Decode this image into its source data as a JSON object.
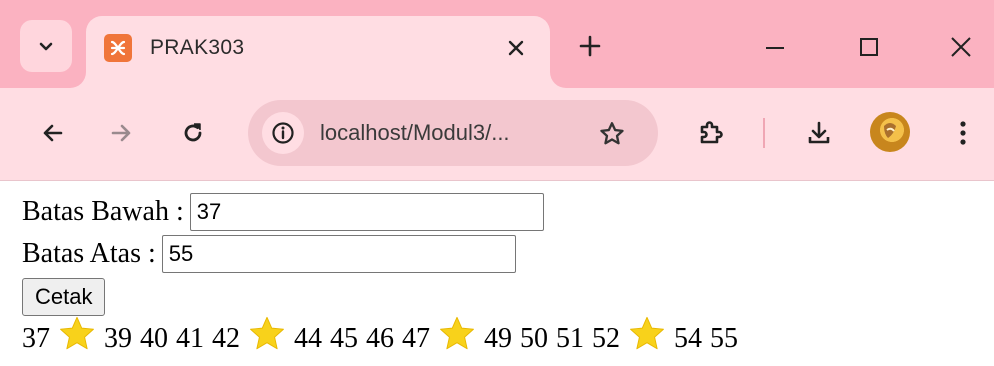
{
  "browser": {
    "tab_title": "PRAK303",
    "url": "localhost/Modul3/..."
  },
  "form": {
    "lower_label": "Batas Bawah :",
    "lower_value": "37",
    "upper_label": "Batas Atas :",
    "upper_value": "55",
    "submit_label": "Cetak"
  },
  "output": [
    {
      "type": "number",
      "text": "37"
    },
    {
      "type": "star"
    },
    {
      "type": "number",
      "text": "39"
    },
    {
      "type": "number",
      "text": "40"
    },
    {
      "type": "number",
      "text": "41"
    },
    {
      "type": "number",
      "text": "42"
    },
    {
      "type": "star"
    },
    {
      "type": "number",
      "text": "44"
    },
    {
      "type": "number",
      "text": "45"
    },
    {
      "type": "number",
      "text": "46"
    },
    {
      "type": "number",
      "text": "47"
    },
    {
      "type": "star"
    },
    {
      "type": "number",
      "text": "49"
    },
    {
      "type": "number",
      "text": "50"
    },
    {
      "type": "number",
      "text": "51"
    },
    {
      "type": "number",
      "text": "52"
    },
    {
      "type": "star"
    },
    {
      "type": "number",
      "text": "54"
    },
    {
      "type": "number",
      "text": "55"
    }
  ],
  "colors": {
    "tabstrip": "#fbb2c1",
    "toolbar": "#ffdde3",
    "star": "#f8d21b"
  }
}
